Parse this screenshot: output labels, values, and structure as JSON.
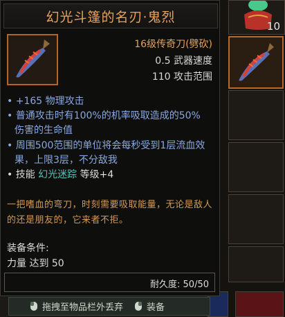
{
  "item": {
    "name": "幻光斗篷的名刃·鬼烈",
    "type": "16级传奇刀(劈砍)",
    "speed": "0.5 武器速度",
    "range": "110 攻击范围"
  },
  "affixes": {
    "line1": "• +165 物理攻击",
    "line2a": "• 普通攻击时有100%的机率吸取造成的50%",
    "line2b": "伤害的生命值",
    "line3a": "• 周围500范围的单位将会每秒受到1层流血效",
    "line3b": "果，上限3层，不分敌我"
  },
  "skill": {
    "prefix": "• 技能",
    "name": "幻光迷踪",
    "level": "等级+4"
  },
  "lore": "一把嗜血的弯刀，时刻需要吸取能量，无论是敌人的还是朋友的，它来者不拒。",
  "requirements": {
    "header": "装备条件:",
    "strength": "力量 达到 50"
  },
  "durability": "耐久度: 50/50",
  "hints": {
    "drop": "拖拽至物品栏外丢弃",
    "equip": "装备"
  },
  "inventory": {
    "stack_count": "10"
  },
  "colors": {
    "title": "#e8a25a",
    "affix_blue": "#8aa8e0",
    "skill_teal": "#56c4b8",
    "lore": "#d39a55",
    "frame": "#b56526"
  }
}
